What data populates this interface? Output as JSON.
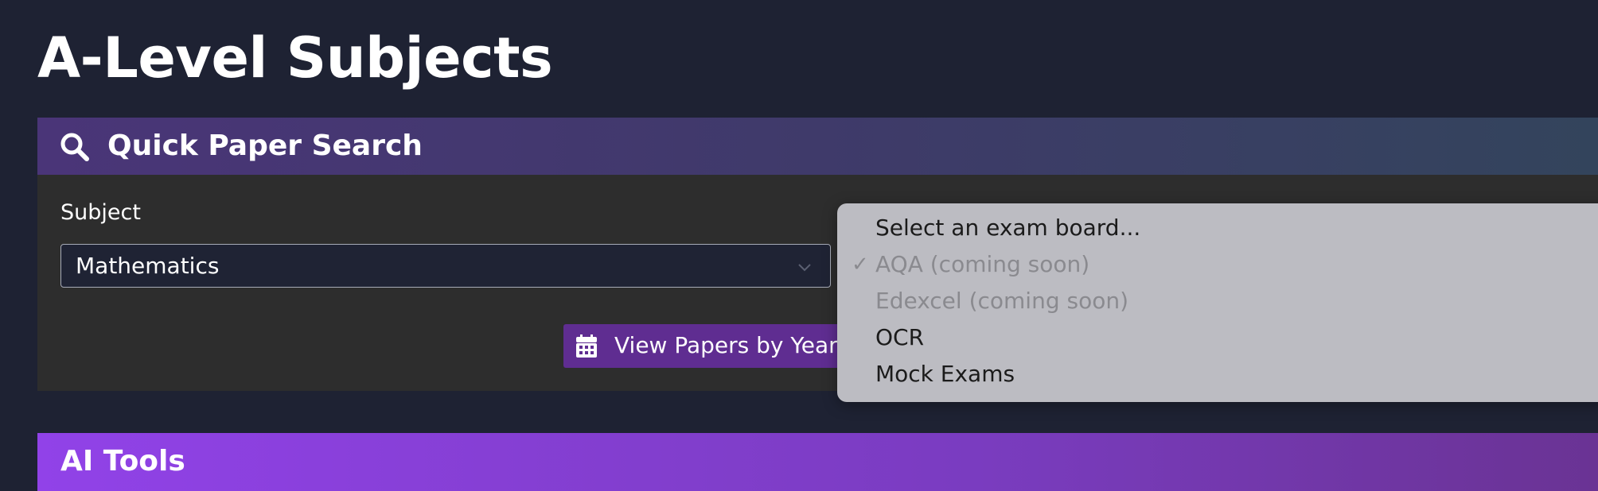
{
  "page": {
    "title": "A-Level Subjects"
  },
  "quick_search": {
    "title": "Quick Paper Search",
    "icon": "search-icon",
    "subject_label": "Subject",
    "subject_value": "Mathematics",
    "view_button_label": "View Papers by Year",
    "view_button_icon": "calendar-icon"
  },
  "exam_board_dropdown": {
    "options": [
      {
        "label": "Select an exam board...",
        "disabled": false,
        "checked": false
      },
      {
        "label": "AQA (coming soon)",
        "disabled": true,
        "checked": true
      },
      {
        "label": "Edexcel (coming soon)",
        "disabled": true,
        "checked": false
      },
      {
        "label": "OCR",
        "disabled": false,
        "checked": false
      },
      {
        "label": "Mock Exams",
        "disabled": false,
        "checked": false
      }
    ]
  },
  "ai_tools": {
    "title": "AI Tools"
  },
  "colors": {
    "background": "#1e2233",
    "card": "#2d2d2d",
    "accent_purple": "#5f2d91",
    "ai_gradient_start": "#9142e8"
  }
}
